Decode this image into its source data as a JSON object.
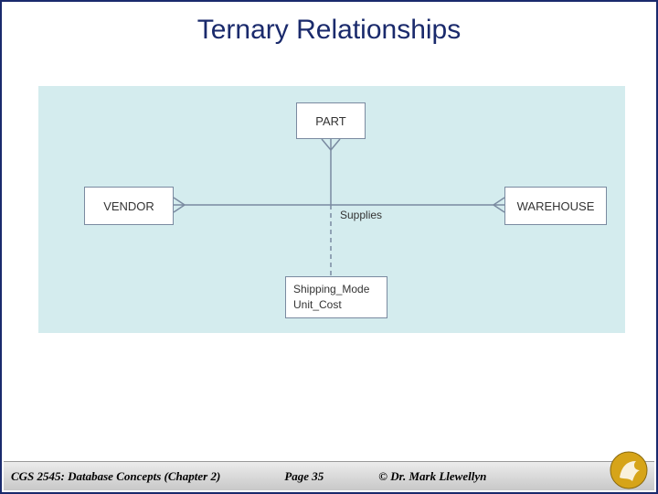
{
  "slide": {
    "title": "Ternary Relationships"
  },
  "diagram": {
    "entities": {
      "top": "PART",
      "left": "VENDOR",
      "right": "WAREHOUSE"
    },
    "relationship_label": "Supplies",
    "attributes": {
      "line1": "Shipping_Mode",
      "line2": "Unit_Cost"
    }
  },
  "footer": {
    "course": "CGS 2545: Database Concepts  (Chapter 2)",
    "page": "Page 35",
    "copyright": "© Dr. Mark Llewellyn"
  },
  "colors": {
    "accent": "#1a2a6c",
    "diagram_bg": "#d4ecee",
    "line": "#7a8aa0",
    "logo_gold": "#d6a419"
  }
}
